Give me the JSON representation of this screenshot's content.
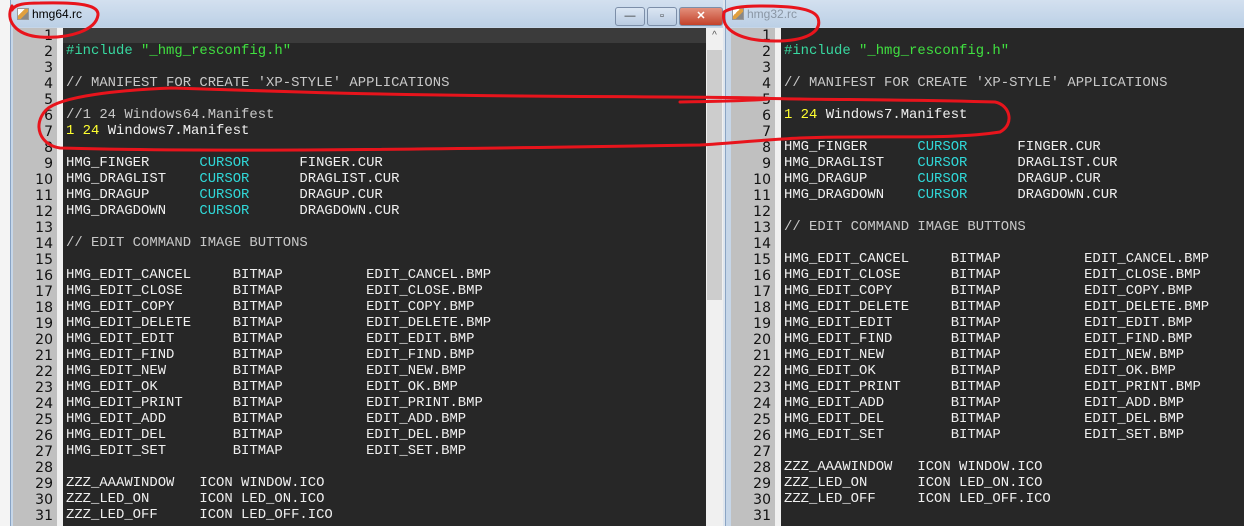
{
  "left_window": {
    "title": "hmg64.rc",
    "controls": {
      "minimize": "—",
      "maximize": "▫",
      "close": "✕"
    },
    "lines": [
      [],
      [
        [
          "p",
          "#include "
        ],
        [
          "s",
          "\"_hmg_resconfig.h\""
        ]
      ],
      [],
      [
        [
          "c",
          "// MANIFEST FOR CREATE 'XP-STYLE' APPLICATIONS"
        ]
      ],
      [],
      [
        [
          "c",
          "//1 24 Windows64.Manifest"
        ]
      ],
      [
        [
          "n",
          "1 24 "
        ],
        [
          "w",
          "Windows7.Manifest"
        ]
      ],
      [],
      [
        [
          "w",
          "HMG_FINGER      "
        ],
        [
          "k",
          "CURSOR      "
        ],
        [
          "w",
          "FINGER.CUR"
        ]
      ],
      [
        [
          "w",
          "HMG_DRAGLIST    "
        ],
        [
          "k",
          "CURSOR      "
        ],
        [
          "w",
          "DRAGLIST.CUR"
        ]
      ],
      [
        [
          "w",
          "HMG_DRAGUP      "
        ],
        [
          "k",
          "CURSOR      "
        ],
        [
          "w",
          "DRAGUP.CUR"
        ]
      ],
      [
        [
          "w",
          "HMG_DRAGDOWN    "
        ],
        [
          "k",
          "CURSOR      "
        ],
        [
          "w",
          "DRAGDOWN.CUR"
        ]
      ],
      [],
      [
        [
          "c",
          "// EDIT COMMAND IMAGE BUTTONS"
        ]
      ],
      [],
      [
        [
          "w",
          "HMG_EDIT_CANCEL     BITMAP          EDIT_CANCEL.BMP"
        ]
      ],
      [
        [
          "w",
          "HMG_EDIT_CLOSE      BITMAP          EDIT_CLOSE.BMP"
        ]
      ],
      [
        [
          "w",
          "HMG_EDIT_COPY       BITMAP          EDIT_COPY.BMP"
        ]
      ],
      [
        [
          "w",
          "HMG_EDIT_DELETE     BITMAP          EDIT_DELETE.BMP"
        ]
      ],
      [
        [
          "w",
          "HMG_EDIT_EDIT       BITMAP          EDIT_EDIT.BMP"
        ]
      ],
      [
        [
          "w",
          "HMG_EDIT_FIND       BITMAP          EDIT_FIND.BMP"
        ]
      ],
      [
        [
          "w",
          "HMG_EDIT_NEW        BITMAP          EDIT_NEW.BMP"
        ]
      ],
      [
        [
          "w",
          "HMG_EDIT_OK         BITMAP          EDIT_OK.BMP"
        ]
      ],
      [
        [
          "w",
          "HMG_EDIT_PRINT      BITMAP          EDIT_PRINT.BMP"
        ]
      ],
      [
        [
          "w",
          "HMG_EDIT_ADD        BITMAP          EDIT_ADD.BMP"
        ]
      ],
      [
        [
          "w",
          "HMG_EDIT_DEL        BITMAP          EDIT_DEL.BMP"
        ]
      ],
      [
        [
          "w",
          "HMG_EDIT_SET        BITMAP          EDIT_SET.BMP"
        ]
      ],
      [],
      [
        [
          "w",
          "ZZZ_AAAWINDOW   ICON WINDOW.ICO"
        ]
      ],
      [
        [
          "w",
          "ZZZ_LED_ON      ICON LED_ON.ICO"
        ]
      ],
      [
        [
          "w",
          "ZZZ_LED_OFF     ICON LED_OFF.ICO"
        ]
      ]
    ]
  },
  "right_window": {
    "title": "hmg32.rc",
    "lines": [
      [],
      [
        [
          "p",
          "#include "
        ],
        [
          "s",
          "\"_hmg_resconfig.h\""
        ]
      ],
      [],
      [
        [
          "c",
          "// MANIFEST FOR CREATE 'XP-STYLE' APPLICATIONS"
        ]
      ],
      [],
      [
        [
          "n",
          "1 24 "
        ],
        [
          "w",
          "Windows7.Manifest"
        ]
      ],
      [],
      [
        [
          "w",
          "HMG_FINGER      "
        ],
        [
          "k",
          "CURSOR      "
        ],
        [
          "w",
          "FINGER.CUR"
        ]
      ],
      [
        [
          "w",
          "HMG_DRAGLIST    "
        ],
        [
          "k",
          "CURSOR      "
        ],
        [
          "w",
          "DRAGLIST.CUR"
        ]
      ],
      [
        [
          "w",
          "HMG_DRAGUP      "
        ],
        [
          "k",
          "CURSOR      "
        ],
        [
          "w",
          "DRAGUP.CUR"
        ]
      ],
      [
        [
          "w",
          "HMG_DRAGDOWN    "
        ],
        [
          "k",
          "CURSOR      "
        ],
        [
          "w",
          "DRAGDOWN.CUR"
        ]
      ],
      [],
      [
        [
          "c",
          "// EDIT COMMAND IMAGE BUTTONS"
        ]
      ],
      [],
      [
        [
          "w",
          "HMG_EDIT_CANCEL     BITMAP          EDIT_CANCEL.BMP"
        ]
      ],
      [
        [
          "w",
          "HMG_EDIT_CLOSE      BITMAP          EDIT_CLOSE.BMP"
        ]
      ],
      [
        [
          "w",
          "HMG_EDIT_COPY       BITMAP          EDIT_COPY.BMP"
        ]
      ],
      [
        [
          "w",
          "HMG_EDIT_DELETE     BITMAP          EDIT_DELETE.BMP"
        ]
      ],
      [
        [
          "w",
          "HMG_EDIT_EDIT       BITMAP          EDIT_EDIT.BMP"
        ]
      ],
      [
        [
          "w",
          "HMG_EDIT_FIND       BITMAP          EDIT_FIND.BMP"
        ]
      ],
      [
        [
          "w",
          "HMG_EDIT_NEW        BITMAP          EDIT_NEW.BMP"
        ]
      ],
      [
        [
          "w",
          "HMG_EDIT_OK         BITMAP          EDIT_OK.BMP"
        ]
      ],
      [
        [
          "w",
          "HMG_EDIT_PRINT      BITMAP          EDIT_PRINT.BMP"
        ]
      ],
      [
        [
          "w",
          "HMG_EDIT_ADD        BITMAP          EDIT_ADD.BMP"
        ]
      ],
      [
        [
          "w",
          "HMG_EDIT_DEL        BITMAP          EDIT_DEL.BMP"
        ]
      ],
      [
        [
          "w",
          "HMG_EDIT_SET        BITMAP          EDIT_SET.BMP"
        ]
      ],
      [],
      [
        [
          "w",
          "ZZZ_AAAWINDOW   ICON WINDOW.ICO"
        ]
      ],
      [
        [
          "w",
          "ZZZ_LED_ON      ICON LED_ON.ICO"
        ]
      ],
      [
        [
          "w",
          "ZZZ_LED_OFF     ICON LED_OFF.ICO"
        ]
      ],
      []
    ]
  },
  "annotation_color": "#e8141c"
}
